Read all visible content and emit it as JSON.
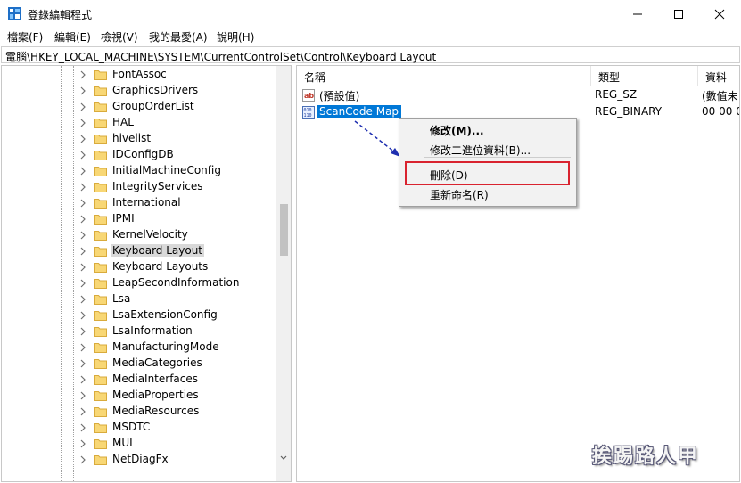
{
  "window": {
    "title": "登錄編輯程式",
    "icon": "regedit-icon",
    "controls": [
      "minimize-icon",
      "maximize-icon",
      "close-icon"
    ]
  },
  "menu": [
    "檔案(F)",
    "編輯(E)",
    "檢視(V)",
    "我的最愛(A)",
    "說明(H)"
  ],
  "address": "電腦\\HKEY_LOCAL_MACHINE\\SYSTEM\\CurrentControlSet\\Control\\Keyboard Layout",
  "tree": {
    "selected": "Keyboard Layout",
    "items": [
      "FontAssoc",
      "GraphicsDrivers",
      "GroupOrderList",
      "HAL",
      "hivelist",
      "IDConfigDB",
      "InitialMachineConfig",
      "IntegrityServices",
      "International",
      "IPMI",
      "KernelVelocity",
      "Keyboard Layout",
      "Keyboard Layouts",
      "LeapSecondInformation",
      "Lsa",
      "LsaExtensionConfig",
      "LsaInformation",
      "ManufacturingMode",
      "MediaCategories",
      "MediaInterfaces",
      "MediaProperties",
      "MediaResources",
      "MSDTC",
      "MUI",
      "NetDiagFx"
    ]
  },
  "list": {
    "headers": {
      "name": "名稱",
      "type": "類型",
      "data": "資料"
    },
    "rows": [
      {
        "icon": "string-value-icon",
        "name": "(預設值)",
        "type": "REG_SZ",
        "data": "(數值未"
      },
      {
        "icon": "binary-value-icon",
        "name": "ScanCode Map",
        "type": "REG_BINARY",
        "data": "00 00 0"
      }
    ]
  },
  "context_menu": {
    "items": [
      "修改(M)...",
      "修改二進位資料(B)...",
      "刪除(D)",
      "重新命名(R)"
    ],
    "highlighted": "刪除(D)",
    "highlight_color": "#d9232f"
  },
  "colors": {
    "selection": "#0078d7",
    "annotation_arrow": "#1f2fb0"
  },
  "watermark": "挨踢路人甲"
}
